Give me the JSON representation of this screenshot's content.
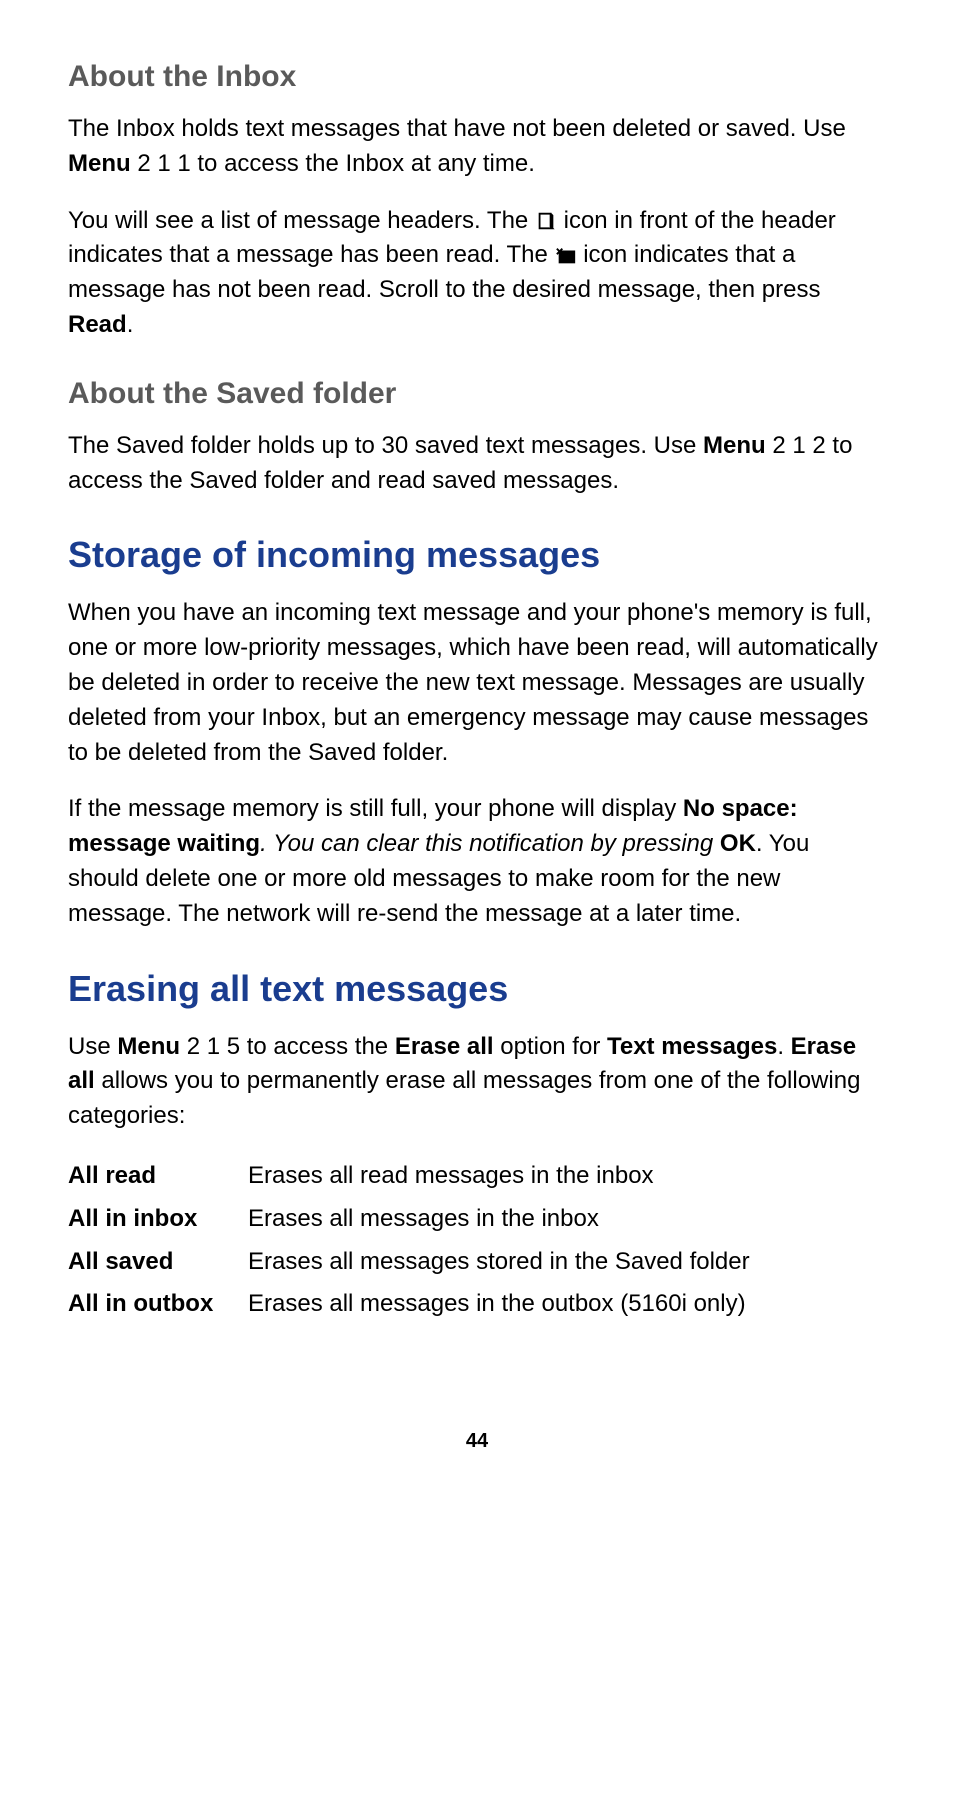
{
  "section_inbox": {
    "heading": "About the Inbox",
    "p1_a": "The Inbox holds text messages that have not been deleted or saved. Use ",
    "p1_menu": "Menu",
    "p1_b": " 2 1 1 to access the Inbox at any time.",
    "p2_a": "You will see a list of message headers. The ",
    "p2_b": " icon in front of the header indicates that a message has been read. The ",
    "p2_c": " icon indicates that a message has not been read. Scroll to the desired message, then press ",
    "p2_read": "Read",
    "p2_d": "."
  },
  "section_saved": {
    "heading": "About the Saved folder",
    "p1_a": "The Saved folder holds up to 30 saved text messages. Use ",
    "p1_menu": "Menu",
    "p1_b": " 2 1 2 to access the Saved folder and read saved messages."
  },
  "section_storage": {
    "heading": "Storage of incoming messages",
    "p1": "When you have an incoming text message and your phone's memory is full, one or more low-priority messages, which have been read, will automatically be deleted in order to receive the new text message. Messages are usually deleted from your Inbox, but an emergency message may cause messages to be deleted from the Saved folder.",
    "p2_a": "If the message memory is still full, your phone will display ",
    "p2_nospace": "No space: message waiting",
    "p2_b": ". You can clear this notification by pressing ",
    "p2_ok": "OK",
    "p2_c": ". You should delete one or more old messages to make room for the new message. The network will re-send the message at a later time."
  },
  "section_erasing": {
    "heading": "Erasing all text messages",
    "p1_a": "Use ",
    "p1_menu": "Menu",
    "p1_b": " 2 1 5 to access the ",
    "p1_eraseall1": "Erase all",
    "p1_c": " option for ",
    "p1_textmsg": "Text messages",
    "p1_d": ". ",
    "p1_eraseall2": "Erase all",
    "p1_e": " allows you to permanently erase all messages from one of the following categories:",
    "rows": [
      {
        "label": "All read",
        "desc": "Erases all read messages in the inbox"
      },
      {
        "label": "All in inbox",
        "desc": "Erases all messages in the inbox"
      },
      {
        "label": "All saved",
        "desc": "Erases all messages stored in the Saved folder"
      },
      {
        "label": "All in outbox",
        "desc": "Erases all messages in the outbox (5160i only)"
      }
    ]
  },
  "page_number": "44"
}
